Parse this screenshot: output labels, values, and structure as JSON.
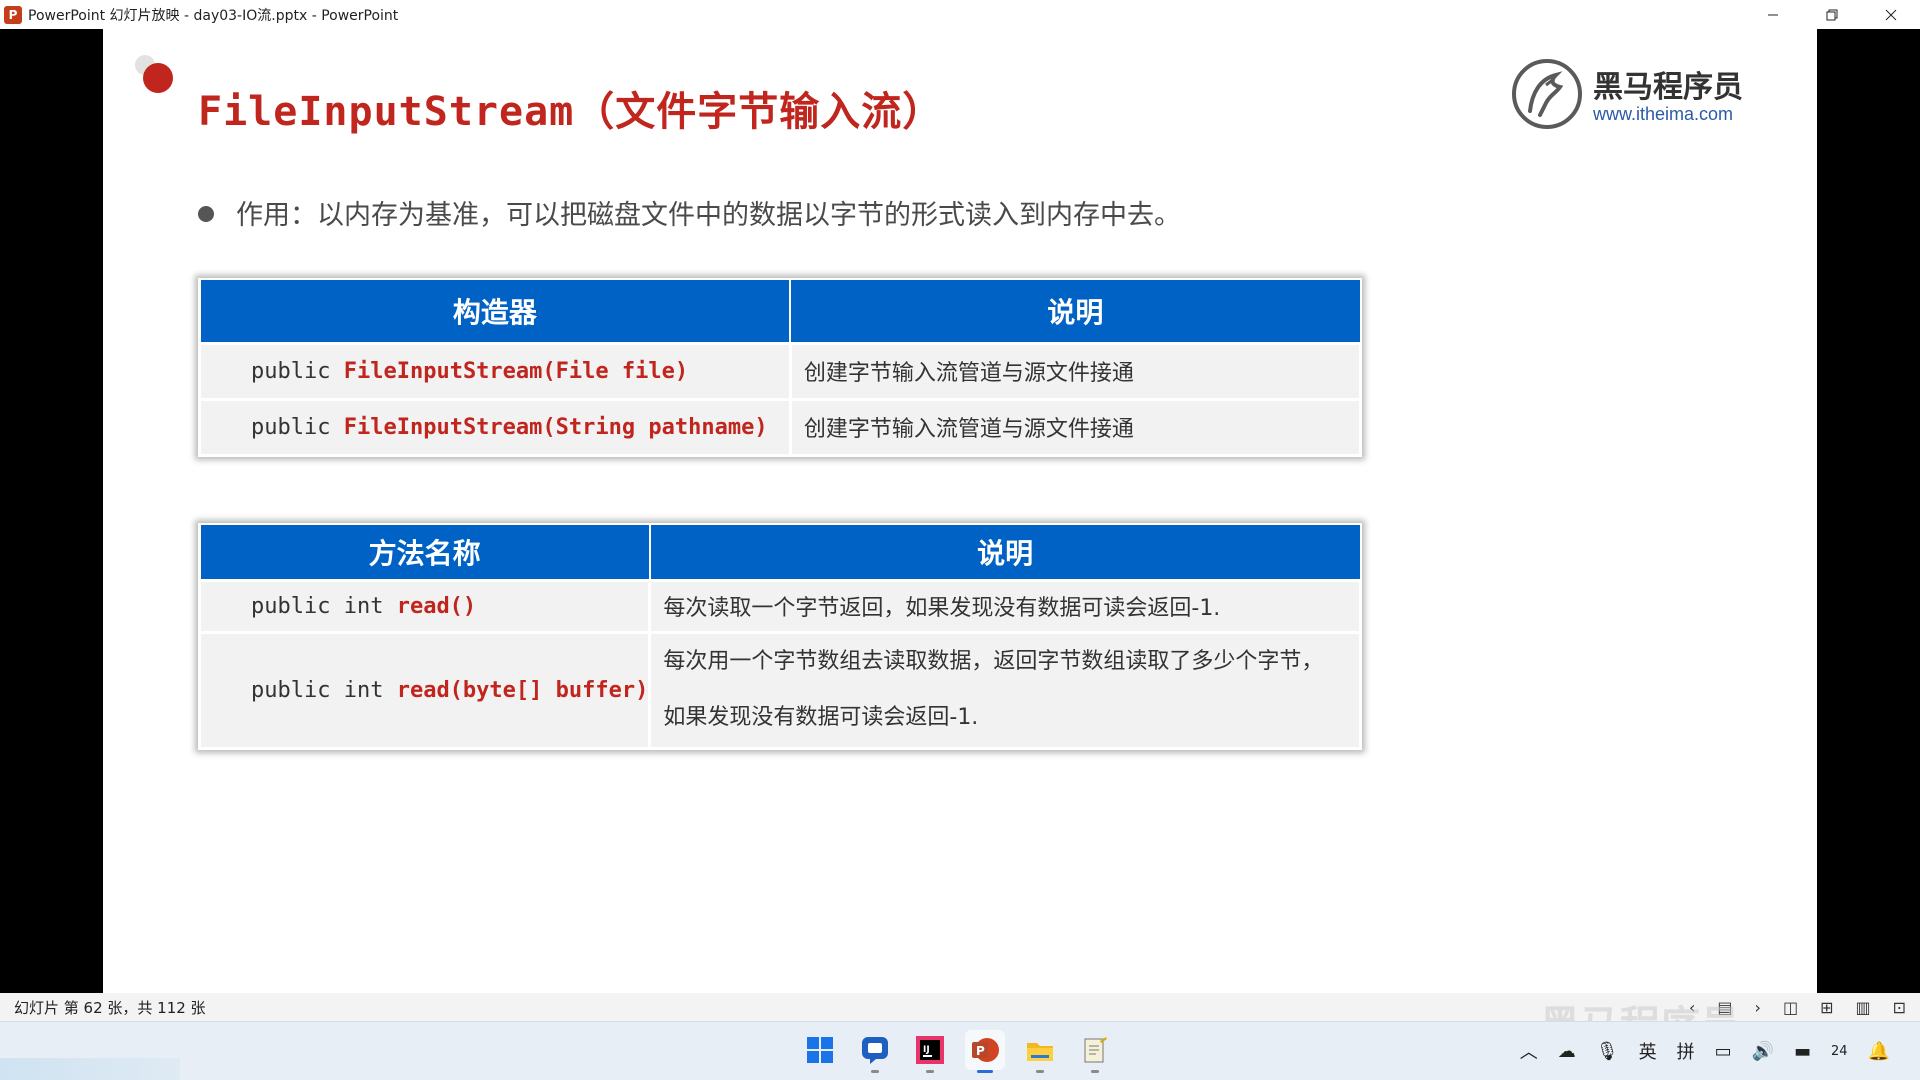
{
  "window": {
    "title": "PowerPoint 幻灯片放映  -  day03-IO流.pptx - PowerPoint",
    "app_icon_letter": "P",
    "controls": [
      "minimize-icon",
      "restore-icon",
      "close-icon"
    ]
  },
  "slide": {
    "title": "FileInputStream（文件字节输入流）",
    "logo": {
      "name": "黑马程序员",
      "url": "www.itheima.com"
    },
    "bullet": "作用：以内存为基准，可以把磁盘文件中的数据以字节的形式读入到内存中去。",
    "constructors_table": {
      "headers": [
        "构造器",
        "说明"
      ],
      "rows": [
        {
          "modifier": "public",
          "signature": "FileInputStream(File file)",
          "desc": "创建字节输入流管道与源文件接通"
        },
        {
          "modifier": "public",
          "signature": "FileInputStream(String pathname)",
          "desc": "创建字节输入流管道与源文件接通"
        }
      ]
    },
    "methods_table": {
      "headers": [
        "方法名称",
        "说明"
      ],
      "rows": [
        {
          "modifier": "public int",
          "signature": "read()",
          "desc_lines": [
            "每次读取一个字节返回，如果发现没有数据可读会返回-1."
          ]
        },
        {
          "modifier": "public int",
          "signature": "read(byte[] buffer)",
          "desc_lines": [
            "每次用一个字节数组去读取数据，返回字节数组读取了多少个字节，",
            "如果发现没有数据可读会返回-1."
          ]
        }
      ]
    }
  },
  "statusbar": {
    "slide_info": "幻灯片 第 62 张，共 112 张",
    "watermark": "黑马程序员",
    "icons": [
      "prev-icon",
      "notes-icon",
      "next-icon",
      "normal-view-icon",
      "slide-sorter-icon",
      "reading-view-icon",
      "slideshow-icon"
    ]
  },
  "taskbar": {
    "apps": [
      "windows-start-icon",
      "chat-icon",
      "intellij-icon",
      "powerpoint-icon",
      "file-explorer-icon",
      "notepad-icon"
    ],
    "tray": {
      "ime_lang": "英",
      "ime_mode": "拼",
      "clock": "24"
    }
  }
}
